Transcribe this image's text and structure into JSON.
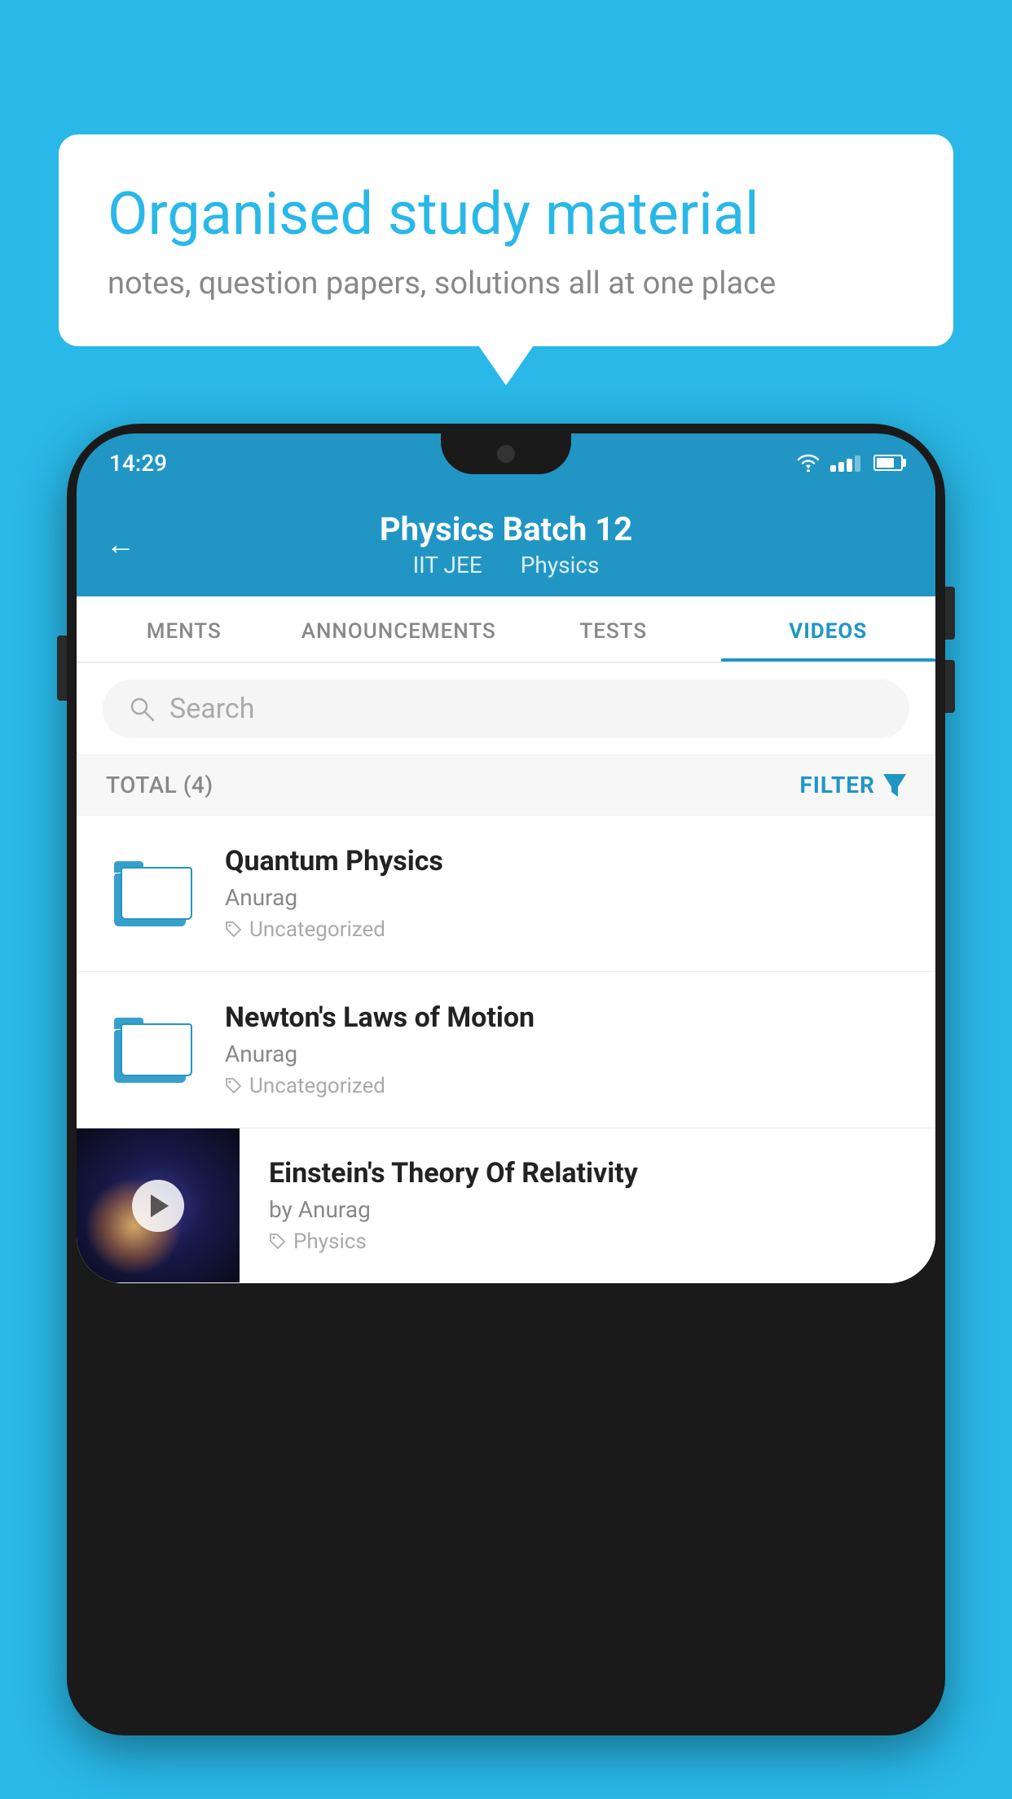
{
  "background_color": "#29b8e8",
  "speech_bubble": {
    "title": "Organised study material",
    "subtitle": "notes, question papers, solutions all at one place"
  },
  "status_bar": {
    "time": "14:29"
  },
  "app_header": {
    "back_label": "←",
    "title": "Physics Batch 12",
    "subtitle_part1": "IIT JEE",
    "subtitle_part2": "Physics"
  },
  "tabs": [
    {
      "label": "MENTS",
      "active": false
    },
    {
      "label": "ANNOUNCEMENTS",
      "active": false
    },
    {
      "label": "TESTS",
      "active": false
    },
    {
      "label": "VIDEOS",
      "active": true
    }
  ],
  "search": {
    "placeholder": "Search"
  },
  "filter_row": {
    "total_label": "TOTAL (4)",
    "filter_label": "FILTER"
  },
  "videos": [
    {
      "id": 1,
      "title": "Quantum Physics",
      "author": "Anurag",
      "tag": "Uncategorized",
      "has_thumbnail": false
    },
    {
      "id": 2,
      "title": "Newton's Laws of Motion",
      "author": "Anurag",
      "tag": "Uncategorized",
      "has_thumbnail": false
    },
    {
      "id": 3,
      "title": "Einstein's Theory Of Relativity",
      "author": "by Anurag",
      "tag": "Physics",
      "has_thumbnail": true
    }
  ]
}
